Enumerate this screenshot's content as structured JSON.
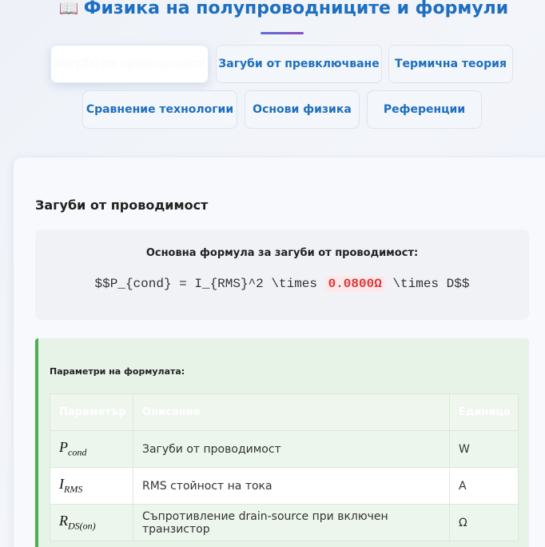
{
  "header": {
    "icon": "open-book-icon",
    "title": "Физика на полупроводниците и формули"
  },
  "tabs": [
    {
      "label": "Загуби от проводимост",
      "active": true
    },
    {
      "label": "Загуби от превключване",
      "active": false
    },
    {
      "label": "Термична теория",
      "active": false
    },
    {
      "label": "Сравнение технологии",
      "active": false
    },
    {
      "label": "Основи физика",
      "active": false
    },
    {
      "label": "Референции",
      "active": false
    }
  ],
  "section": {
    "title": "Загуби от проводимост",
    "formula_label": "Основна формула за загуби от проводимост:",
    "formula_prefix": "$$P_{cond} = I_{RMS}^2 \\times ",
    "formula_value": "0.0800Ω",
    "formula_suffix": " \\times D$$"
  },
  "params": {
    "title": "Параметри на формулата:",
    "headers": [
      "Параметър",
      "Описание",
      "Единица"
    ],
    "rows": [
      {
        "symbol_main": "P",
        "symbol_sub": "cond",
        "description": "Загуби от проводимост",
        "unit": "W"
      },
      {
        "symbol_main": "I",
        "symbol_sub": "RMS",
        "description": "RMS стойност на тока",
        "unit": "A"
      },
      {
        "symbol_main": "R",
        "symbol_sub": "DS(on)",
        "description": "Съпротивление drain-source при включен транзистор",
        "unit": "Ω"
      }
    ]
  },
  "colors": {
    "accent": "#1e6fbf",
    "highlight_bg": "#fde8ea",
    "highlight_text": "#d63a3a",
    "panel_border": "#4caf50"
  }
}
